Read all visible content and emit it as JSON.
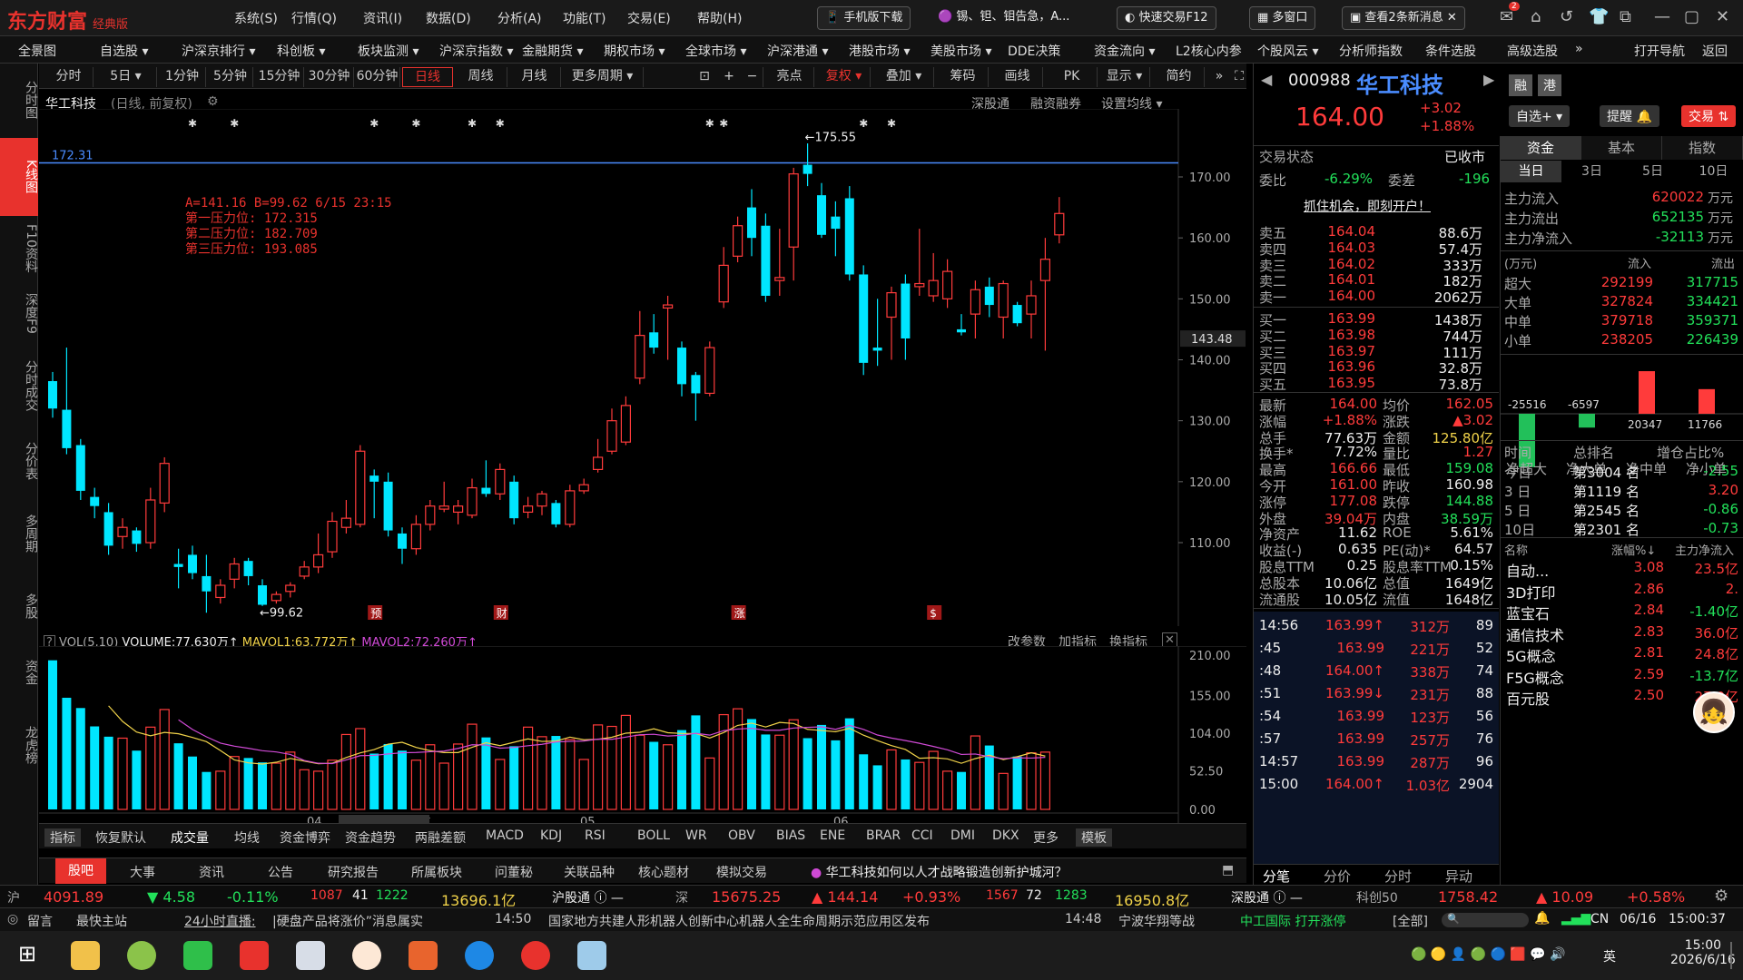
{
  "app": {
    "name": "东方财富",
    "edition": "经典版"
  },
  "menu": [
    "系统(S)",
    "行情(Q)",
    "资讯(I)",
    "数据(D)",
    "分析(A)",
    "功能(T)",
    "交易(E)",
    "帮助(H)"
  ],
  "toolbar": {
    "mobile": "手机版下载",
    "news_ticker": "锡、钽、钼告急，A...",
    "quick_trade": "快速交易F12",
    "multi_window": "多窗口",
    "news_count": "查看2条新消息",
    "mail_badge": "2"
  },
  "nav": [
    "全景图",
    "自选股 ▾",
    "沪深京排行 ▾",
    "科创板 ▾",
    "板块监测 ▾",
    "沪深京指数 ▾",
    "金融期货 ▾",
    "期权市场 ▾",
    "全球市场 ▾",
    "沪深港通 ▾",
    "港股市场 ▾",
    "美股市场 ▾",
    "DDE决策",
    "资金流向 ▾",
    "L2核心内参",
    "个股风云 ▾",
    "分析师指数",
    "条件选股",
    "高级选股",
    "»",
    "打开导航",
    "返回"
  ],
  "sidebar": [
    "分时图",
    "K线图",
    "F10资料",
    "深度F9",
    "分时成交",
    "分价表",
    "多周期",
    "多股",
    "资金",
    "龙虎榜"
  ],
  "periods": [
    "分时",
    "5日 ▾",
    "1分钟",
    "5分钟",
    "15分钟",
    "30分钟",
    "60分钟",
    "日线",
    "周线",
    "月线",
    "更多周期 ▾"
  ],
  "chart_tools": [
    "亮点",
    "复权 ▾",
    "叠加 ▾",
    "筹码",
    "画线",
    "PK",
    "显示 ▾",
    "简约"
  ],
  "chart_header": {
    "name": "华工科技",
    "mode": "(日线, 前复权)",
    "links": [
      "深股通",
      "融资融券",
      "设置均线 ▾"
    ]
  },
  "price_line": "172.31",
  "annot": {
    "line1": "A=141.16  B=99.62  6/15  23:15",
    "line2": "第一压力位: 172.315",
    "line3": "第二压力位: 182.709",
    "line4": "第三压力位: 193.085"
  },
  "hi_label": "←175.55",
  "lo_label": "←99.62",
  "cur_axis_label": "143.48",
  "price_axis": [
    "170.00",
    "160.00",
    "150.00",
    "140.00",
    "130.00",
    "120.00",
    "110.00"
  ],
  "vol_axis": [
    "210.00",
    "155.00",
    "104.00",
    "52.50",
    "0.00"
  ],
  "vol_header": {
    "name": "VOL(5,10)",
    "volume": "VOLUME:77.630万",
    "ma1": "MAVOL1:63.772万",
    "ma2": "MAVOL2:72.260万",
    "links": [
      "改参数",
      "加指标",
      "换指标"
    ]
  },
  "date_axis": [
    "04",
    "2026/04/07/二",
    "05",
    "06"
  ],
  "event_markers": [
    "预",
    "财",
    "涨",
    "$"
  ],
  "indicators": [
    "指标",
    "恢复默认",
    "成交量",
    "均线",
    "资金博弈",
    "资金趋势",
    "两融差额",
    "MACD",
    "KDJ",
    "RSI",
    "BOLL",
    "WR",
    "OBV",
    "BIAS",
    "ENE",
    "BRAR",
    "CCI",
    "DMI",
    "DKX",
    "更多",
    "模板"
  ],
  "bottom_tabs": [
    "股吧",
    "大事",
    "资讯",
    "公告",
    "研究报告",
    "所属板块",
    "问董秘",
    "关联品种",
    "核心题材",
    "模拟交易"
  ],
  "bottom_question": "华工科技如何以人才战略锻造创新护城河？",
  "stock": {
    "code": "000988",
    "name": "华工科技",
    "price": "164.00",
    "change": "+3.02",
    "pct": "+1.88%",
    "tags": [
      "融",
      "港"
    ]
  },
  "actions": {
    "watchlist": "自选+ ▾",
    "alert": "提醒",
    "trade": "交易"
  },
  "status": {
    "label": "交易状态",
    "value": "已收市",
    "wb_label": "委比",
    "wb": "-6.29%",
    "wc_label": "委差",
    "wc": "-196",
    "promo": "抓住机会，即刻开户！"
  },
  "sells": [
    {
      "l": "卖五",
      "p": "164.04",
      "v": "88.6万"
    },
    {
      "l": "卖四",
      "p": "164.03",
      "v": "57.4万"
    },
    {
      "l": "卖三",
      "p": "164.02",
      "v": "333万"
    },
    {
      "l": "卖二",
      "p": "164.01",
      "v": "182万"
    },
    {
      "l": "卖一",
      "p": "164.00",
      "v": "2062万"
    }
  ],
  "buys": [
    {
      "l": "买一",
      "p": "163.99",
      "v": "1438万"
    },
    {
      "l": "买二",
      "p": "163.98",
      "v": "744万"
    },
    {
      "l": "买三",
      "p": "163.97",
      "v": "111万"
    },
    {
      "l": "买四",
      "p": "163.96",
      "v": "32.8万"
    },
    {
      "l": "买五",
      "p": "163.95",
      "v": "73.8万"
    }
  ],
  "quote": [
    {
      "l1": "最新",
      "v1": "164.00",
      "c1": "red",
      "l2": "均价",
      "v2": "162.05",
      "c2": "red"
    },
    {
      "l1": "涨幅",
      "v1": "+1.88%",
      "c1": "red",
      "l2": "涨跌",
      "v2": "▲3.02",
      "c2": "red"
    },
    {
      "l1": "总手",
      "v1": "77.63万",
      "c1": "wht",
      "l2": "金额",
      "v2": "125.80亿",
      "c2": "yel"
    },
    {
      "l1": "换手*",
      "v1": "7.72%",
      "c1": "wht",
      "l2": "量比",
      "v2": "1.27",
      "c2": "red"
    },
    {
      "l1": "最高",
      "v1": "166.66",
      "c1": "red",
      "l2": "最低",
      "v2": "159.08",
      "c2": "grn"
    },
    {
      "l1": "今开",
      "v1": "161.00",
      "c1": "red",
      "l2": "昨收",
      "v2": "160.98",
      "c2": "wht"
    },
    {
      "l1": "涨停",
      "v1": "177.08",
      "c1": "red",
      "l2": "跌停",
      "v2": "144.88",
      "c2": "grn"
    },
    {
      "l1": "外盘",
      "v1": "39.04万",
      "c1": "red",
      "l2": "内盘",
      "v2": "38.59万",
      "c2": "grn"
    },
    {
      "l1": "净资产",
      "v1": "11.62",
      "c1": "wht",
      "l2": "ROE",
      "v2": "5.61%",
      "c2": "wht"
    },
    {
      "l1": "收益(-)",
      "v1": "0.635",
      "c1": "wht",
      "l2": "PE(动)*",
      "v2": "64.57",
      "c2": "wht"
    },
    {
      "l1": "股息TTM",
      "v1": "0.25",
      "c1": "wht",
      "l2": "股息率TTM",
      "v2": "0.15%",
      "c2": "wht"
    },
    {
      "l1": "总股本",
      "v1": "10.06亿",
      "c1": "wht",
      "l2": "总值",
      "v2": "1649亿",
      "c2": "wht"
    },
    {
      "l1": "流通股",
      "v1": "10.05亿",
      "c1": "wht",
      "l2": "流值",
      "v2": "1648亿",
      "c2": "wht"
    }
  ],
  "ticks": [
    {
      "t": "14:56",
      "p": "163.99↑",
      "v": "312万",
      "n": "89"
    },
    {
      "t": ":45",
      "p": "163.99",
      "v": "221万",
      "n": "52"
    },
    {
      "t": ":48",
      "p": "164.00↑",
      "v": "338万",
      "n": "74"
    },
    {
      "t": ":51",
      "p": "163.99↓",
      "v": "231万",
      "n": "88"
    },
    {
      "t": ":54",
      "p": "163.99",
      "v": "123万",
      "n": "56"
    },
    {
      "t": ":57",
      "p": "163.99",
      "v": "257万",
      "n": "76"
    },
    {
      "t": "14:57",
      "p": "163.99",
      "v": "287万",
      "n": "96"
    },
    {
      "t": "15:00",
      "p": "164.00↑",
      "v": "1.03亿",
      "n": "2904"
    }
  ],
  "tick_tabs": [
    "分笔",
    "分价",
    "分时",
    "异动"
  ],
  "far_tabs": [
    "资金",
    "基本",
    "指数"
  ],
  "period_tabs": [
    "当日",
    "3日",
    "5日",
    "10日"
  ],
  "flows": [
    {
      "l": "主力流入",
      "v": "620022",
      "u": "万元",
      "c": "red"
    },
    {
      "l": "主力流出",
      "v": "652135",
      "u": "万元",
      "c": "grn"
    },
    {
      "l": "主力净流入",
      "v": "-32113",
      "u": "万元",
      "c": "grn"
    }
  ],
  "flow_header": {
    "unit": "(万元)",
    "in": "流入",
    "out": "流出"
  },
  "flow_rows": [
    {
      "l": "超大",
      "i": "292199",
      "o": "317715"
    },
    {
      "l": "大单",
      "i": "327824",
      "o": "334421"
    },
    {
      "l": "中单",
      "i": "379718",
      "o": "359371"
    },
    {
      "l": "小单",
      "i": "238205",
      "o": "226439"
    }
  ],
  "flow_bars": {
    "labels": [
      "净超大",
      "净大单",
      "净中单",
      "净小单"
    ],
    "values": [
      -25516,
      -6597,
      20347,
      11766
    ]
  },
  "rank_header": {
    "c1": "时间",
    "c2": "总排名",
    "c3": "增仓占比%"
  },
  "ranks": [
    {
      "t": "今日",
      "r": "第3004 名",
      "v": "-2.55",
      "c": "grn"
    },
    {
      "t": "3 日",
      "r": "第1119 名",
      "v": "3.20",
      "c": "red"
    },
    {
      "t": "5 日",
      "r": "第2545 名",
      "v": "-0.86",
      "c": "grn"
    },
    {
      "t": "10日",
      "r": "第2301 名",
      "v": "-0.73",
      "c": "grn"
    }
  ],
  "sector_header": {
    "c1": "名称",
    "c2": "涨幅%↓",
    "c3": "主力净流入"
  },
  "sectors": [
    {
      "n": "自动...",
      "p": "3.08",
      "f": "23.5亿",
      "c": "red"
    },
    {
      "n": "3D打印",
      "p": "2.86",
      "f": "2.",
      "c": "red"
    },
    {
      "n": "蓝宝石",
      "p": "2.84",
      "f": "-1.40亿",
      "c": "grn"
    },
    {
      "n": "通信技术",
      "p": "2.83",
      "f": "36.0亿",
      "c": "red"
    },
    {
      "n": "5G概念",
      "p": "2.81",
      "f": "24.8亿",
      "c": "red"
    },
    {
      "n": "F5G概念",
      "p": "2.59",
      "f": "-13.7亿",
      "c": "grn"
    },
    {
      "n": "百元股",
      "p": "2.50",
      "f": "27.0亿",
      "c": "red"
    }
  ],
  "index_bar": {
    "sh_label": "沪",
    "sh": "4091.89",
    "sh_chg": "▼ 4.58",
    "sh_pct": "-0.11%",
    "sh_up": "1087",
    "sh_flat": "41",
    "sh_down": "1222",
    "sh_amt": "13696.1亿",
    "hgt": "沪股通 ⓘ —",
    "sz_label": "深",
    "sz": "15675.25",
    "sz_chg": "▲ 144.14",
    "sz_pct": "+0.93%",
    "sz_up": "1567",
    "sz_flat": "72",
    "sz_down": "1283",
    "sz_amt": "16950.8亿",
    "sgt": "深股通 ⓘ —",
    "kc_label": "科创50",
    "kc": "1758.42",
    "kc_chg": "▲ 10.09",
    "kc_pct": "+0.58%"
  },
  "news": {
    "msg": "留言",
    "home": "最快主站",
    "live": "24小时直播:",
    "item1": "|硬盘产品将涨价”消息属实",
    "t1": "14:50",
    "item2": "国家地方共建人形机器人创新中心机器人全生命周期示范应用区发布",
    "t2": "14:48",
    "item3": "宁波华翔等战",
    "broker": "中工国际 打开涨停",
    "all": "[全部]",
    "net": "CN",
    "date": "06/16",
    "time": "15:00:37"
  },
  "taskbar": {
    "time": "15:00",
    "date": "2026/6/16",
    "ime": "英"
  },
  "chart_data": {
    "type": "candlestick",
    "title": "华工科技 (日线, 前复权)",
    "ohlc": [
      [
        136.5,
        132.0,
        138.0,
        130.5
      ],
      [
        131.8,
        125.5,
        142.0,
        124.5
      ],
      [
        126.0,
        118.5,
        127.0,
        117.0
      ],
      [
        117.5,
        116.0,
        119.0,
        114.0
      ],
      [
        115.0,
        109.5,
        116.5,
        108.0
      ],
      [
        111.0,
        112.5,
        114.0,
        109.0
      ],
      [
        112.0,
        109.8,
        112.5,
        108.5
      ],
      [
        110.0,
        117.0,
        119.0,
        109.0
      ],
      [
        116.5,
        123.0,
        124.0,
        115.0
      ],
      [
        106.5,
        106.0,
        109.0,
        102.5
      ],
      [
        108.0,
        105.0,
        109.5,
        104.0
      ],
      [
        104.5,
        102.0,
        108.0,
        98.5
      ],
      [
        101.0,
        103.0,
        104.0,
        100.0
      ],
      [
        104.0,
        106.5,
        107.5,
        102.5
      ],
      [
        107.0,
        104.5,
        107.5,
        103.0
      ],
      [
        103.0,
        99.8,
        104.0,
        99.6
      ],
      [
        100.5,
        101.5,
        102.0,
        100.0
      ],
      [
        102.0,
        103.0,
        103.5,
        101.0
      ],
      [
        104.5,
        106.0,
        107.0,
        104.0
      ],
      [
        106.0,
        108.0,
        111.5,
        105.0
      ],
      [
        108.5,
        113.5,
        115.0,
        107.5
      ],
      [
        112.5,
        114.0,
        117.0,
        111.5
      ],
      [
        113.0,
        125.0,
        126.0,
        112.5
      ],
      [
        121.0,
        120.0,
        122.0,
        114.0
      ],
      [
        120.0,
        112.0,
        121.5,
        111.0
      ],
      [
        111.5,
        109.0,
        112.5,
        106.5
      ],
      [
        109.0,
        113.0,
        114.5,
        108.0
      ],
      [
        113.0,
        116.0,
        117.0,
        112.0
      ],
      [
        115.5,
        116.0,
        120.0,
        115.0
      ],
      [
        115.0,
        116.0,
        117.0,
        113.0
      ],
      [
        114.5,
        119.0,
        120.5,
        114.0
      ],
      [
        119.0,
        118.0,
        123.5,
        117.5
      ],
      [
        118.0,
        122.0,
        123.0,
        117.0
      ],
      [
        120.0,
        114.0,
        121.0,
        113.0
      ],
      [
        115.0,
        116.0,
        117.5,
        114.0
      ],
      [
        116.0,
        118.0,
        118.5,
        114.5
      ],
      [
        116.5,
        113.0,
        117.0,
        112.5
      ],
      [
        113.0,
        118.5,
        119.5,
        112.5
      ],
      [
        118.5,
        119.5,
        120.5,
        118.0
      ],
      [
        122.0,
        124.0,
        127.0,
        121.5
      ],
      [
        125.0,
        130.0,
        132.0,
        124.5
      ],
      [
        126.5,
        132.5,
        134.0,
        126.0
      ],
      [
        137.0,
        144.0,
        148.0,
        136.0
      ],
      [
        144.5,
        142.0,
        147.5,
        141.0
      ],
      [
        148.5,
        149.0,
        150.5,
        140.0
      ],
      [
        142.0,
        136.0,
        143.0,
        134.0
      ],
      [
        137.5,
        134.5,
        138.0,
        130.0
      ],
      [
        134.5,
        142.0,
        143.0,
        134.0
      ],
      [
        149.5,
        155.5,
        158.5,
        148.5
      ],
      [
        157.0,
        162.0,
        163.5,
        156.0
      ],
      [
        165.0,
        160.0,
        168.0,
        157.0
      ],
      [
        162.0,
        150.5,
        164.0,
        149.5
      ],
      [
        153.0,
        153.5,
        161.5,
        150.5
      ],
      [
        158.5,
        170.5,
        171.5,
        153.0
      ],
      [
        172.0,
        170.5,
        175.5,
        168.5
      ],
      [
        167.0,
        160.5,
        169.0,
        160.0
      ],
      [
        163.5,
        161.5,
        166.0,
        157.0
      ],
      [
        166.5,
        154.0,
        168.5,
        153.0
      ],
      [
        154.0,
        139.5,
        155.5,
        137.5
      ],
      [
        142.0,
        141.5,
        150.0,
        139.0
      ],
      [
        147.0,
        151.0,
        152.0,
        140.0
      ],
      [
        152.5,
        143.5,
        154.0,
        140.0
      ],
      [
        152.0,
        152.5,
        161.5,
        150.5
      ],
      [
        150.5,
        153.0,
        157.5,
        149.5
      ],
      [
        150.0,
        154.5,
        156.5,
        148.5
      ],
      [
        145.0,
        144.5,
        147.5,
        144.0
      ],
      [
        147.5,
        151.5,
        153.0,
        143.5
      ],
      [
        152.0,
        149.0,
        153.5,
        147.0
      ],
      [
        147.0,
        152.5,
        153.0,
        143.5
      ],
      [
        149.0,
        146.0,
        149.5,
        145.5
      ],
      [
        147.5,
        150.5,
        153.0,
        143.5
      ],
      [
        153.0,
        156.5,
        160.0,
        141.5
      ],
      [
        160.5,
        164.0,
        166.7,
        159.1
      ]
    ],
    "volume": [
      203,
      152,
      138,
      113,
      99,
      97,
      80,
      112,
      136,
      90,
      72,
      51,
      52,
      72,
      70,
      64,
      63,
      78,
      54,
      52,
      67,
      102,
      110,
      76,
      89,
      80,
      67,
      88,
      63,
      89,
      116,
      98,
      68,
      86,
      112,
      99,
      100,
      95,
      68,
      115,
      113,
      128,
      101,
      92,
      88,
      108,
      128,
      70,
      129,
      137,
      123,
      102,
      101,
      122,
      97,
      115,
      94,
      124,
      75,
      60,
      81,
      68,
      64,
      79,
      52,
      51,
      100,
      87,
      49,
      72,
      77,
      78
    ],
    "ylim": [
      99.62,
      175.55
    ],
    "annotations": {
      "A": 141.16,
      "B": 99.62,
      "pressure": [
        172.315,
        182.709,
        193.085
      ]
    },
    "vol_ylim": [
      0,
      210
    ]
  },
  "colors": {
    "up": "#ff3b3b",
    "down": "#00e6ff",
    "ma5": "#f1d34a",
    "ma10": "#d04ad6",
    "brand": "#e8322d"
  }
}
